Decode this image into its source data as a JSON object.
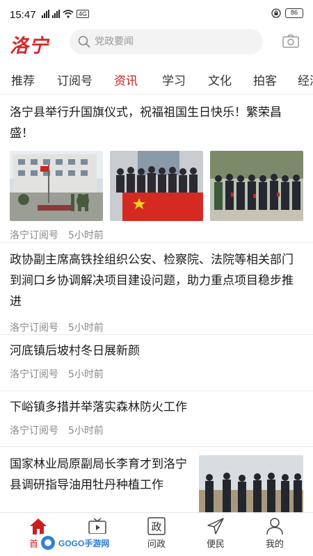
{
  "status_bar": {
    "time": "15:47",
    "network": "4G",
    "battery": "86"
  },
  "header": {
    "logo": "洛宁",
    "search_placeholder": "党政要闻"
  },
  "tabs": [
    {
      "label": "推荐"
    },
    {
      "label": "订阅号"
    },
    {
      "label": "资讯"
    },
    {
      "label": "学习"
    },
    {
      "label": "文化"
    },
    {
      "label": "拍客"
    },
    {
      "label": "经济"
    }
  ],
  "active_tab": "资讯",
  "articles": [
    {
      "title": "洛宁县举行升国旗仪式，祝福祖国生日快乐！繁荣昌盛！",
      "source": "洛宁订阅号",
      "time": "5小时前"
    },
    {
      "title": "政协副主席高铁拴组织公安、检察院、法院等相关部门到涧口乡协调解决项目建设问题，助力重点项目稳步推进",
      "source": "洛宁订阅号",
      "time": "5小时前"
    },
    {
      "title": "河底镇后坡村冬日展新颜",
      "source": "洛宁订阅号",
      "time": "5小时前"
    },
    {
      "title": "下峪镇多措并举落实森林防火工作",
      "source": "洛宁订阅号",
      "time": "5小时前"
    },
    {
      "title": "国家林业局原副局长李育才到洛宁县调研指导油用牡丹种植工作"
    }
  ],
  "bottom_nav": [
    {
      "label": "首页",
      "icon": "home-icon"
    },
    {
      "label": "视听",
      "icon": "tv-icon"
    },
    {
      "label": "问政",
      "icon": "politics-icon",
      "glyph": "政"
    },
    {
      "label": "便民",
      "icon": "paper-plane-icon"
    },
    {
      "label": "我的",
      "icon": "person-icon"
    }
  ],
  "watermark": "GOGO手游网",
  "colors": {
    "accent": "#c82020",
    "logo": "#d22a2a",
    "meta": "#888888"
  }
}
